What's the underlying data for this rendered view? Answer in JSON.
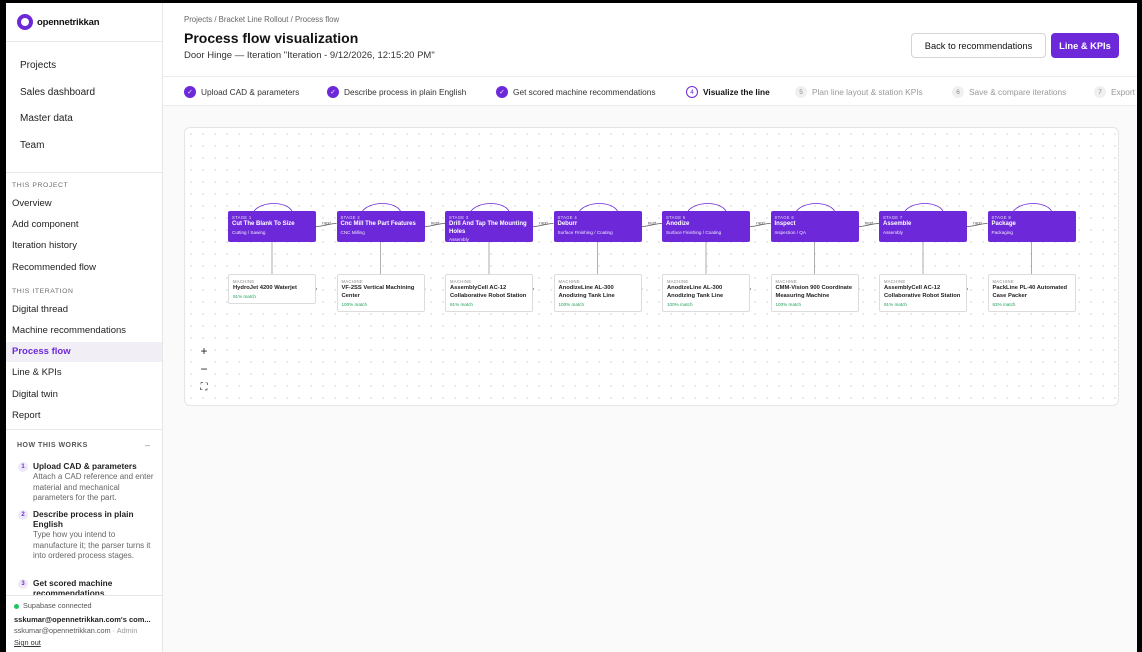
{
  "brand": {
    "name": "opennetrikkan",
    "accent": "#6d28d9"
  },
  "sidebar": {
    "main": [
      "Projects",
      "Sales dashboard",
      "Master data",
      "Team"
    ],
    "this_project_title": "THIS PROJECT",
    "this_project": [
      "Overview",
      "Add component",
      "Iteration history",
      "Recommended flow"
    ],
    "this_iteration_title": "THIS ITERATION",
    "this_iteration": [
      "Digital thread",
      "Machine recommendations",
      "Process flow",
      "Line & KPIs",
      "Digital twin",
      "Report"
    ],
    "active_item": "Process flow",
    "how": {
      "title": "HOW THIS WORKS",
      "collapse": "–",
      "steps": [
        {
          "num": "1",
          "title": "Upload CAD & parameters",
          "desc": "Attach a CAD reference and enter material and mechanical parameters for the part."
        },
        {
          "num": "2",
          "title": "Describe process in plain English",
          "desc": "Type how you intend to manufacture it; the parser turns it into ordered process stages."
        },
        {
          "num": "3",
          "title": "Get scored machine recommendations",
          "desc": ""
        }
      ]
    },
    "footer": {
      "status": "Supabase connected",
      "account": "sskumar@opennetrikkan.com's com...",
      "email": "sskumar@opennetrikkan.com",
      "role": "· Admin",
      "signout": "Sign out"
    }
  },
  "header": {
    "breadcrumb": "Projects / Bracket Line Rollout / Process flow",
    "title": "Process flow visualization",
    "subtitle": "Door Hinge — Iteration \"Iteration - 9/12/2026, 12:15:20 PM\"",
    "back_button": "Back to recommendations",
    "primary_button": "Line & KPIs"
  },
  "progress_steps": [
    {
      "num": "✓",
      "label": "Upload CAD & parameters",
      "state": "done"
    },
    {
      "num": "✓",
      "label": "Describe process in plain English",
      "state": "done"
    },
    {
      "num": "✓",
      "label": "Get scored machine recommendations",
      "state": "done"
    },
    {
      "num": "4",
      "label": "Visualize the line",
      "state": "current"
    },
    {
      "num": "5",
      "label": "Plan line layout & station KPIs",
      "state": "future"
    },
    {
      "num": "6",
      "label": "Save & compare iterations",
      "state": "future"
    },
    {
      "num": "7",
      "label": "Export",
      "state": "future"
    }
  ],
  "flow": {
    "edge_label": "next",
    "stages": [
      {
        "tag": "STAGE 1",
        "name": "Cut The Blank To Size",
        "category": "Cutting / Sawing",
        "machine": "HydroJet 4200 Waterjet",
        "match": "91% match"
      },
      {
        "tag": "STAGE 2",
        "name": "Cnc Mill The Part Features",
        "category": "CNC Milling",
        "machine": "VF-2SS Vertical Machining Center",
        "match": "100% match"
      },
      {
        "tag": "STAGE 3",
        "name": "Drill And Tap The Mounting Holes",
        "category": "Assembly",
        "machine": "AssemblyCell AC-12 Collaborative Robot Station",
        "match": "91% match"
      },
      {
        "tag": "STAGE 4",
        "name": "Deburr",
        "category": "Surface Finishing / Coating",
        "machine": "AnodizeLine AL-300 Anodizing Tank Line",
        "match": "100% match"
      },
      {
        "tag": "STAGE 5",
        "name": "Anodize",
        "category": "Surface Finishing / Coating",
        "machine": "AnodizeLine AL-300 Anodizing Tank Line",
        "match": "100% match"
      },
      {
        "tag": "STAGE 6",
        "name": "Inspect",
        "category": "Inspection / QA",
        "machine": "CMM-Vision 900 Coordinate Measuring Machine",
        "match": "100% match"
      },
      {
        "tag": "STAGE 7",
        "name": "Assemble",
        "category": "Assembly",
        "machine": "AssemblyCell AC-12 Collaborative Robot Station",
        "match": "91% match"
      },
      {
        "tag": "STAGE 8",
        "name": "Package",
        "category": "Packaging",
        "machine": "PackLine PL-40 Automated Case Packer",
        "match": "63% match"
      }
    ],
    "machine_tag": "MACHINE",
    "zoom": {
      "in": "+",
      "out": "−",
      "fit": "⛶"
    }
  }
}
